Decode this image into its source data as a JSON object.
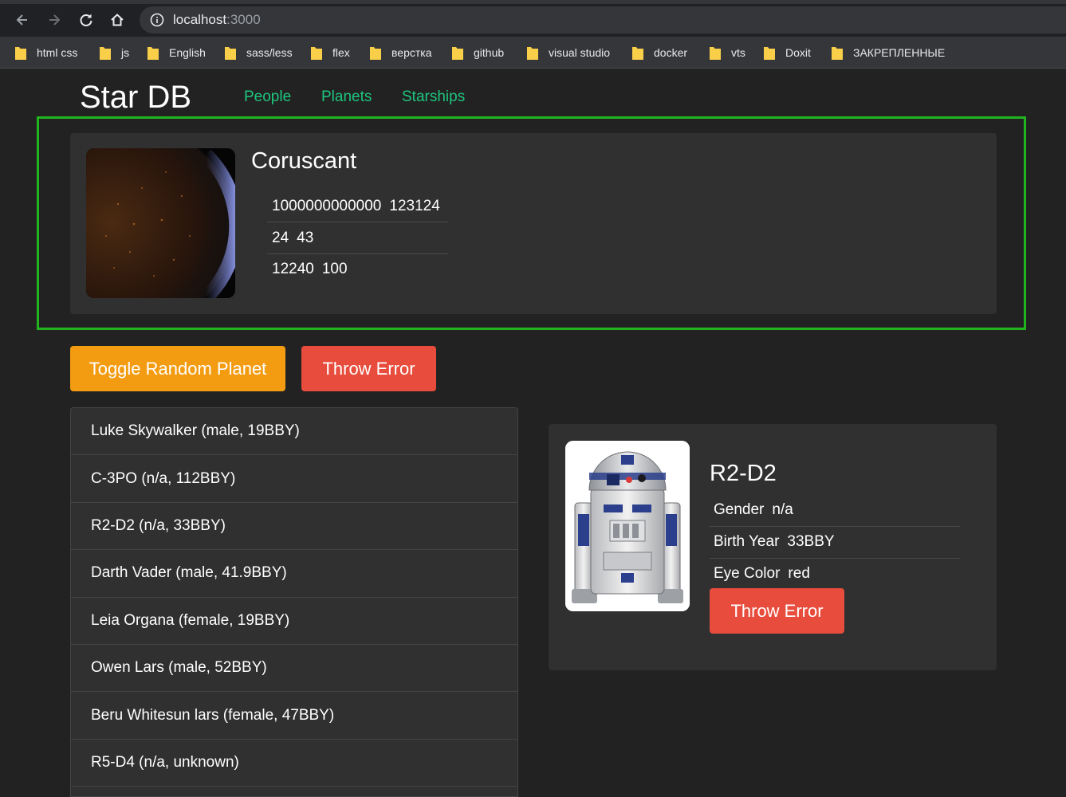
{
  "browser": {
    "url_host": "localhost",
    "url_port": ":3000",
    "bookmarks": [
      "html css",
      "js",
      "English",
      "sass/less",
      "flex",
      "верстка",
      "github",
      "visual studio",
      "docker",
      "vts",
      "Doxit",
      "ЗАКРЕПЛЕННЫЕ"
    ]
  },
  "header": {
    "brand": "Star DB",
    "nav": [
      "People",
      "Planets",
      "Starships"
    ]
  },
  "random_planet": {
    "name": "Coruscant",
    "rows": [
      {
        "label": "1000000000000",
        "value": "123124"
      },
      {
        "label": "24",
        "value": "43"
      },
      {
        "label": "12240",
        "value": "100"
      }
    ]
  },
  "buttons": {
    "toggle_label": "Toggle Random Planet",
    "throw_label": "Throw Error"
  },
  "people_list": [
    "Luke Skywalker (male, 19BBY)",
    "C-3PO (n/a, 112BBY)",
    "R2-D2 (n/a, 33BBY)",
    "Darth Vader (male, 41.9BBY)",
    "Leia Organa (female, 19BBY)",
    "Owen Lars (male, 52BBY)",
    "Beru Whitesun lars (female, 47BBY)",
    "R5-D4 (n/a, unknown)"
  ],
  "person_details": {
    "name": "R2-D2",
    "rows": [
      {
        "label": "Gender",
        "value": "n/a"
      },
      {
        "label": "Birth Year",
        "value": "33BBY"
      },
      {
        "label": "Eye Color",
        "value": "red"
      }
    ],
    "throw_label": "Throw Error"
  },
  "colors": {
    "accent_green": "#1ec67e",
    "warning": "#f39c12",
    "danger": "#e74c3c",
    "frame": "#22b41f"
  }
}
